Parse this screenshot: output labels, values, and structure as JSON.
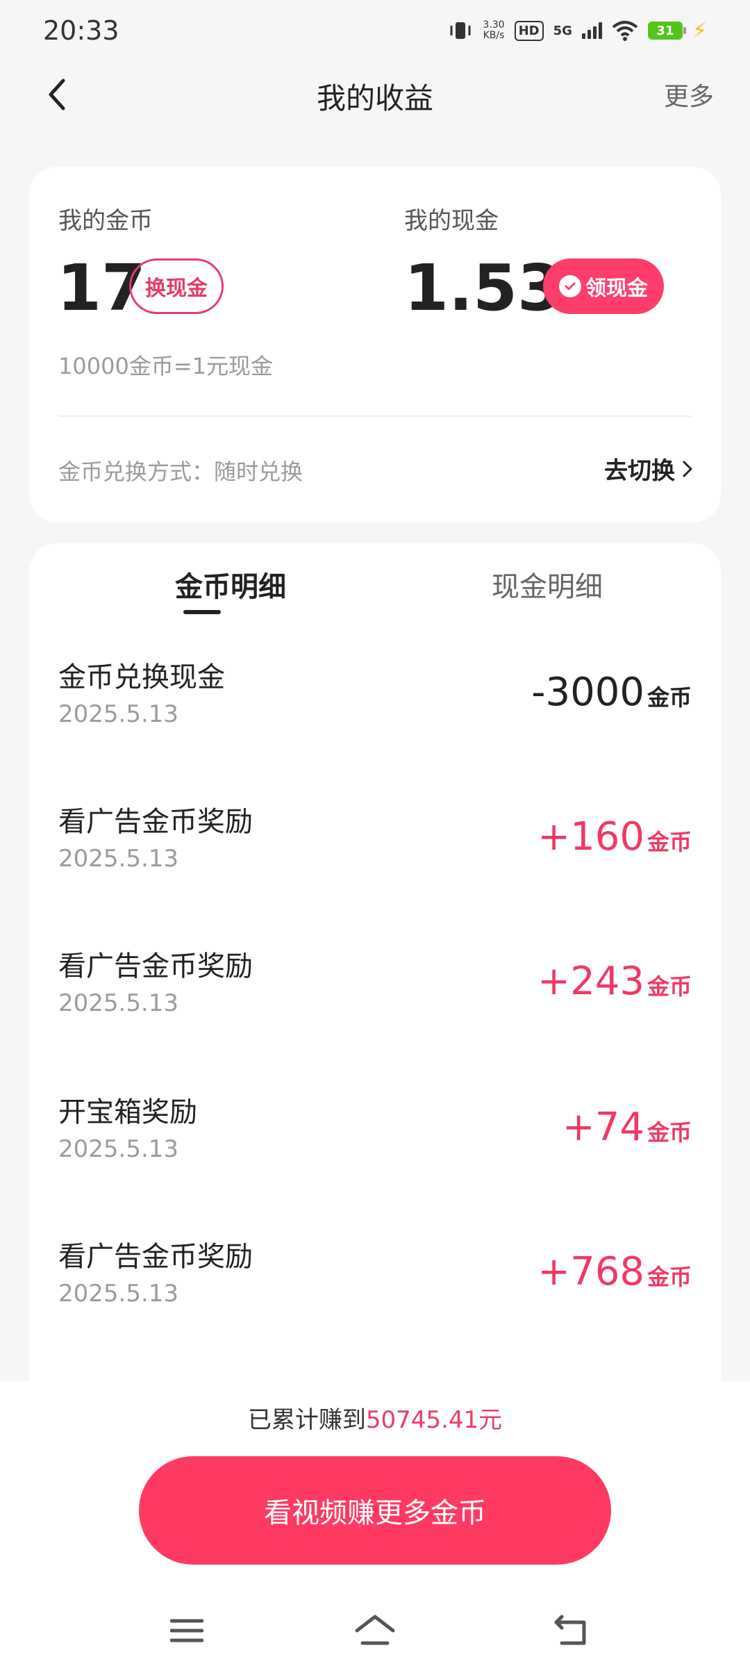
{
  "status_bar": {
    "time": "20:33",
    "speed_value": "3.30",
    "speed_unit": "KB/s",
    "hd": "HD",
    "network": "5G",
    "battery": "31"
  },
  "header": {
    "title": "我的收益",
    "more": "更多"
  },
  "summary": {
    "coin_label": "我的金币",
    "coin_value": "17",
    "exchange_button": "换现金",
    "cash_label": "我的现金",
    "cash_value": "1.53",
    "withdraw_button": "领现金",
    "rate_note": "10000金币=1元现金",
    "method_text": "金币兑换方式：随时兑换",
    "switch_link": "去切换"
  },
  "tabs": {
    "coin_detail": "金币明细",
    "cash_detail": "现金明细"
  },
  "records": [
    {
      "title": "金币兑换现金",
      "date": "2025.5.13",
      "amount": "-3000",
      "unit": "金币"
    },
    {
      "title": "看广告金币奖励",
      "date": "2025.5.13",
      "amount": "+160",
      "unit": "金币"
    },
    {
      "title": "看广告金币奖励",
      "date": "2025.5.13",
      "amount": "+243",
      "unit": "金币"
    },
    {
      "title": "开宝箱奖励",
      "date": "2025.5.13",
      "amount": "+74",
      "unit": "金币"
    },
    {
      "title": "看广告金币奖励",
      "date": "2025.5.13",
      "amount": "+768",
      "unit": "金币"
    }
  ],
  "footer": {
    "total_prefix": "已累计赚到",
    "total_amount": "50745.41元",
    "cta": "看视频赚更多金币"
  },
  "colors": {
    "accent": "#fe3a63",
    "positive": "#ee3a64"
  }
}
